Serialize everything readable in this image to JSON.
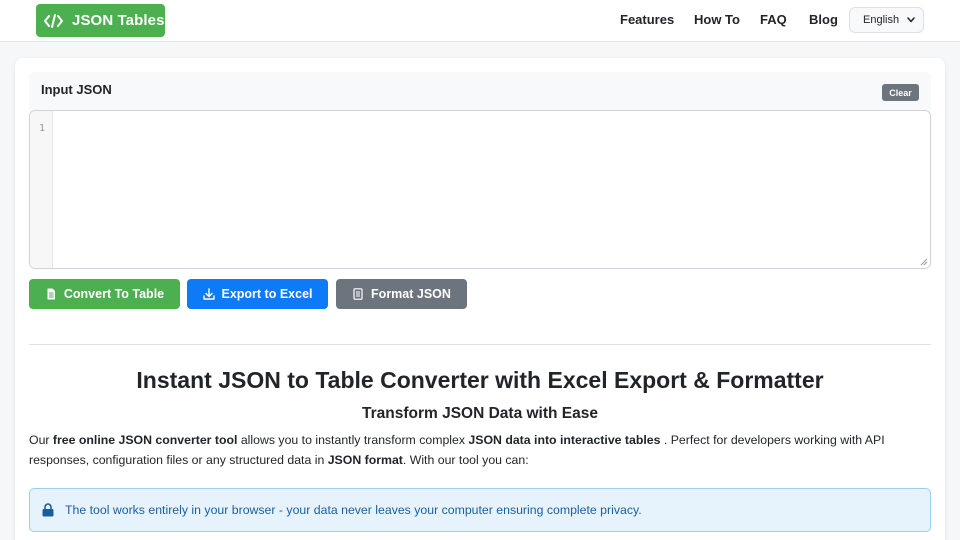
{
  "header": {
    "logo_text": "JSON Tables",
    "nav": [
      {
        "label": "Features"
      },
      {
        "label": "How To"
      },
      {
        "label": "FAQ"
      },
      {
        "label": "Blog"
      }
    ],
    "language": "English"
  },
  "input": {
    "title": "Input JSON",
    "clear_label": "Clear",
    "line_number": "1",
    "value": ""
  },
  "actions": {
    "convert_label": "Convert To Table",
    "export_label": "Export to Excel",
    "format_label": "Format JSON"
  },
  "content": {
    "title": "Instant JSON to Table Converter with Excel Export & Formatter",
    "subtitle": "Transform JSON Data with Ease",
    "para_1": "Our ",
    "para_b1": "free online JSON converter tool",
    "para_2": " allows you to instantly transform complex ",
    "para_b2": "JSON data into interactive tables",
    "para_3": " . Perfect for developers working with API responses, configuration files or any structured data in ",
    "para_b3": "JSON format",
    "para_4": ". With our tool you can:",
    "alert": "The tool works entirely in your browser - your data never leaves your computer ensuring complete privacy."
  },
  "colors": {
    "brand_green": "#4caf50",
    "primary_blue": "#0d7bf7",
    "secondary_gray": "#6c757d",
    "alert_bg": "#e7f3fc"
  }
}
